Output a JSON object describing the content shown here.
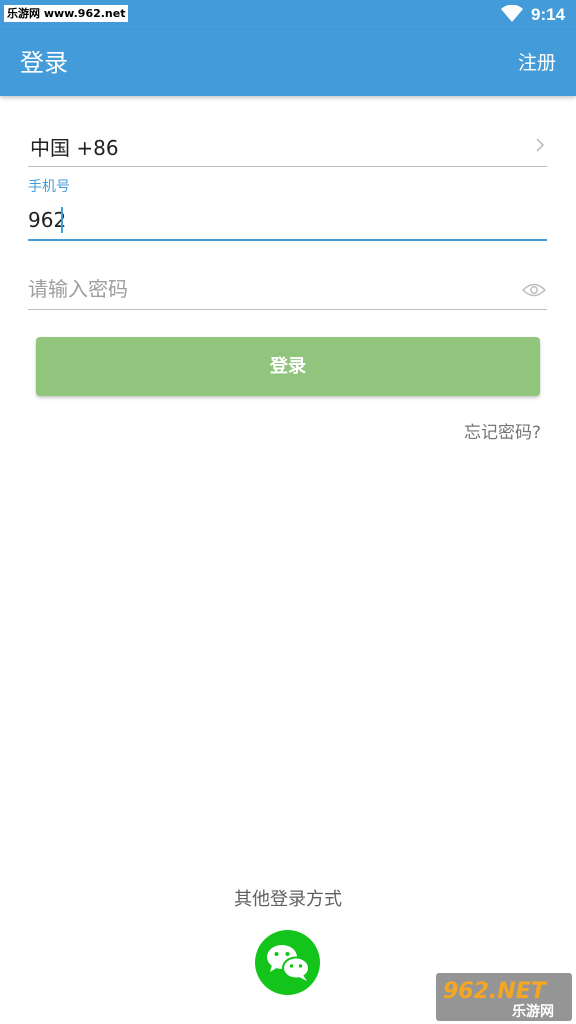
{
  "statusbar": {
    "watermark": "乐游网 www.962.net",
    "time": "9:14",
    "wifi_icon": "wifi-icon"
  },
  "appbar": {
    "title": "登录",
    "action": "注册"
  },
  "form": {
    "country_code": "中国 +86",
    "phone_label": "手机号",
    "phone_value": "962",
    "password_placeholder": "请输入密码",
    "login_label": "登录",
    "forgot_label": "忘记密码?"
  },
  "footer": {
    "other_label": "其他登录方式",
    "wechat_icon": "wechat-icon"
  },
  "watermark_bottom": {
    "brand": "962.NET",
    "sub": "乐游网"
  },
  "colors": {
    "primary": "#439cd9",
    "button": "#91c47d",
    "wechat": "#13c41b"
  }
}
